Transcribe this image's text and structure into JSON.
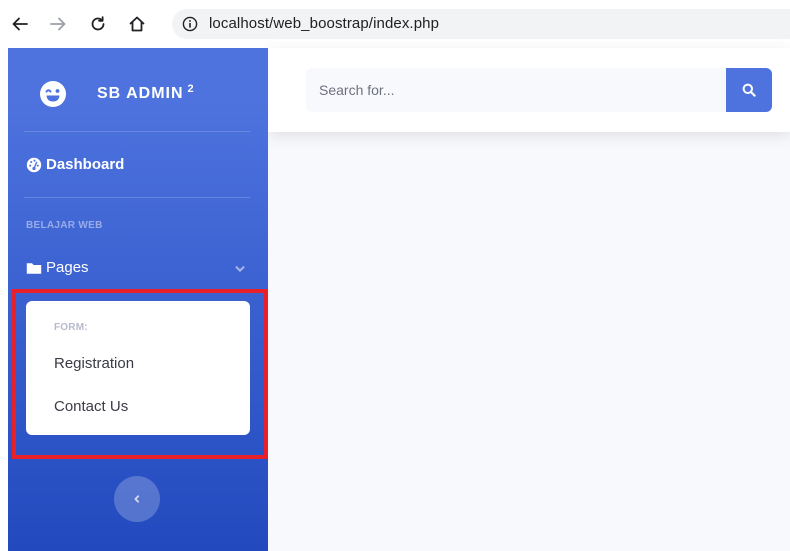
{
  "browser": {
    "url": "localhost/web_boostrap/index.php",
    "icons": [
      "back-arrow-icon",
      "forward-arrow-icon",
      "reload-icon",
      "home-icon",
      "info-icon"
    ]
  },
  "sidebar": {
    "brand": {
      "name": "SB ADMIN",
      "superscript": "2",
      "icon": "laugh-wink-icon"
    },
    "dashboard_label": "Dashboard",
    "heading": "BELAJAR WEB",
    "pages_label": "Pages",
    "collapse": {
      "header": "FORM:",
      "items": [
        {
          "label": "Registration"
        },
        {
          "label": "Contact Us"
        }
      ]
    },
    "toggler_icon": "angle-left-icon"
  },
  "topbar": {
    "search_placeholder": "Search for...",
    "search_value": ""
  },
  "colors": {
    "primary": "#4e73df",
    "sidebar_gradient_end": "#224abe",
    "highlight": "#e8202a",
    "content_bg": "#f8f9fc"
  }
}
